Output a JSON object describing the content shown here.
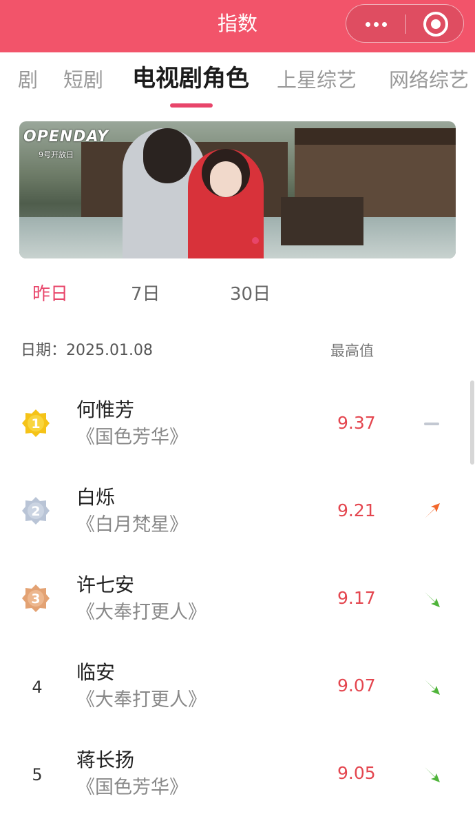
{
  "header": {
    "title": "指数",
    "more_icon": "more-dots-icon",
    "close_icon": "target-circle-icon",
    "bg_color": "#f2546a"
  },
  "tabs": [
    {
      "label": "剧"
    },
    {
      "label": "短剧"
    },
    {
      "label": "电视剧角色",
      "active": true
    },
    {
      "label": "上星综艺"
    },
    {
      "label": "网络综艺"
    }
  ],
  "banner": {
    "logo_text": "OPENDAY",
    "subtitle": "9号开放日"
  },
  "periods": [
    {
      "label": "昨日",
      "active": true
    },
    {
      "label": "7日"
    },
    {
      "label": "30日"
    }
  ],
  "list_header": {
    "date_label": "日期：",
    "date_value": "2025.01.08",
    "max_label": "最高值"
  },
  "accent_color": "#e8456a",
  "rows": [
    {
      "rank": "1",
      "medal": "gold-medal-icon",
      "name": "何惟芳",
      "show": "《国色芳华》",
      "score": "9.37",
      "trend": "flat"
    },
    {
      "rank": "2",
      "medal": "silver-medal-icon",
      "name": "白烁",
      "show": "《白月梵星》",
      "score": "9.21",
      "trend": "up"
    },
    {
      "rank": "3",
      "medal": "bronze-medal-icon",
      "name": "许七安",
      "show": "《大奉打更人》",
      "score": "9.17",
      "trend": "down"
    },
    {
      "rank": "4",
      "name": "临安",
      "show": "《大奉打更人》",
      "score": "9.07",
      "trend": "down"
    },
    {
      "rank": "5",
      "name": "蒋长扬",
      "show": "《国色芳华》",
      "score": "9.05",
      "trend": "down"
    }
  ]
}
